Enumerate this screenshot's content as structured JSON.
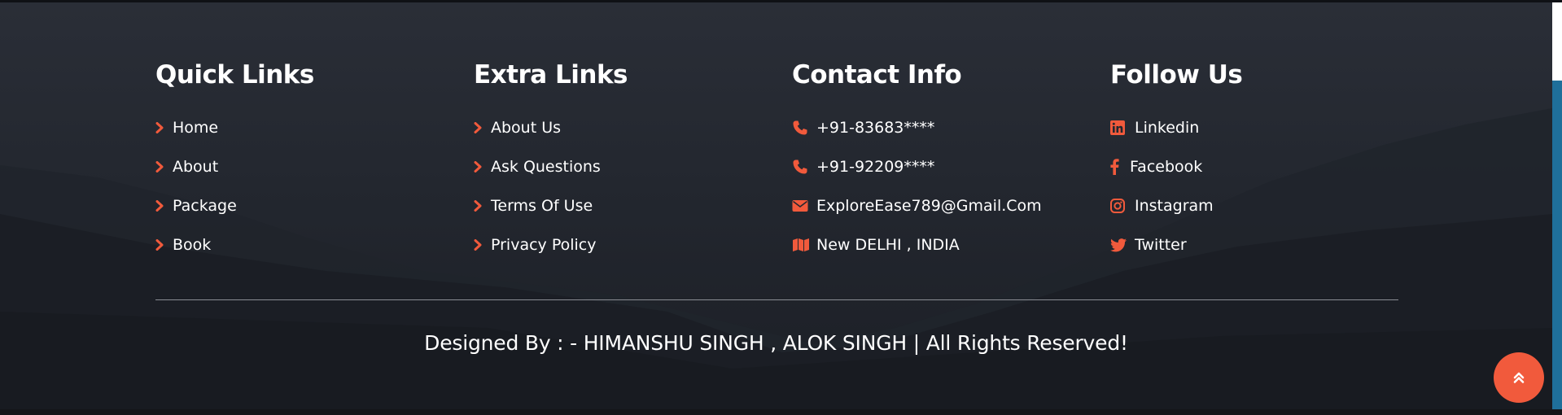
{
  "columns": {
    "quick": {
      "title": "Quick Links",
      "items": [
        {
          "label": "Home",
          "icon": "chevron-right-icon"
        },
        {
          "label": "About",
          "icon": "chevron-right-icon"
        },
        {
          "label": "Package",
          "icon": "chevron-right-icon"
        },
        {
          "label": "Book",
          "icon": "chevron-right-icon"
        }
      ]
    },
    "extra": {
      "title": "Extra Links",
      "items": [
        {
          "label": "About Us",
          "icon": "chevron-right-icon"
        },
        {
          "label": "Ask Questions",
          "icon": "chevron-right-icon"
        },
        {
          "label": "Terms Of Use",
          "icon": "chevron-right-icon"
        },
        {
          "label": "Privacy Policy",
          "icon": "chevron-right-icon"
        }
      ]
    },
    "contact": {
      "title": "Contact Info",
      "items": [
        {
          "label": "+91-83683****",
          "icon": "phone-icon"
        },
        {
          "label": "+91-92209****",
          "icon": "phone-icon"
        },
        {
          "label": "ExploreEase789@Gmail.Com",
          "icon": "envelope-icon"
        },
        {
          "label": "New DELHI , INDIA",
          "icon": "map-icon"
        }
      ]
    },
    "follow": {
      "title": "Follow Us",
      "items": [
        {
          "label": "Linkedin",
          "icon": "linkedin-icon"
        },
        {
          "label": "Facebook",
          "icon": "facebook-icon"
        },
        {
          "label": "Instagram",
          "icon": "instagram-icon"
        },
        {
          "label": "Twitter",
          "icon": "twitter-icon"
        }
      ]
    }
  },
  "credit": "Designed By : - HIMANSHU SINGH , ALOK SINGH | All Rights Reserved!",
  "scroll_top_icon": "double-chevron-up-icon",
  "colors": {
    "accent": "#f15a3c",
    "background": "#23272f",
    "text": "#ffffff",
    "divider": "#8a8d94"
  }
}
